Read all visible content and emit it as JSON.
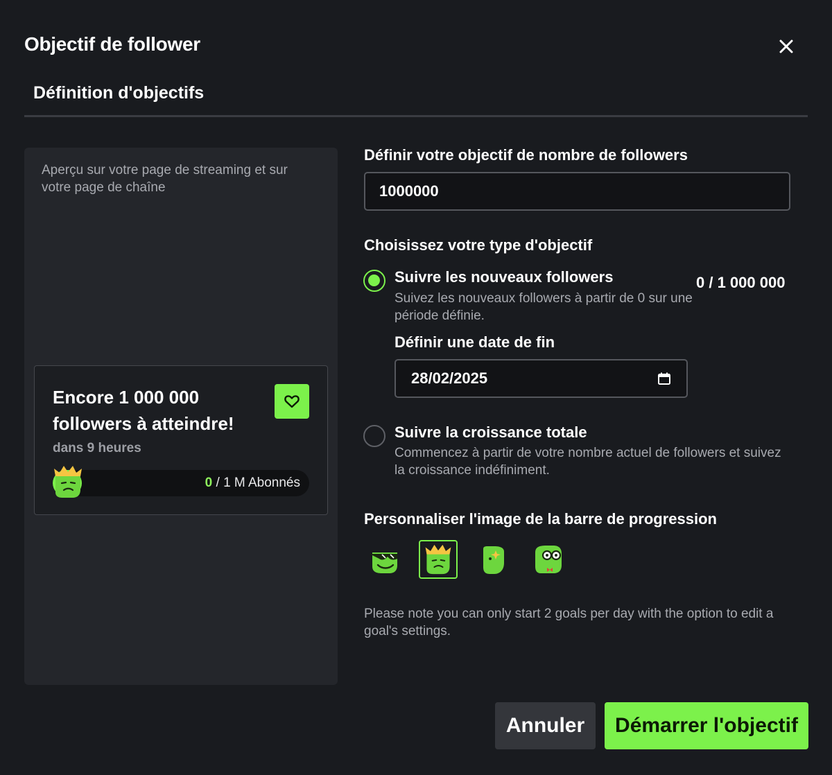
{
  "dialog": {
    "title": "Objectif de follower",
    "tab": "Définition d'objectifs"
  },
  "preview": {
    "caption": "Aperçu sur votre page de streaming et sur votre page de chaîne",
    "card": {
      "title": "Encore 1 000 000 followers à atteindre!",
      "time": "dans 9 heures",
      "current": "0",
      "target": " / 1 M Abonnés",
      "progress_fraction": 0.0
    }
  },
  "form": {
    "goal_label": "Définir votre objectif de nombre de followers",
    "goal_value": "1000000",
    "type_label": "Choisissez votre type d'objectif",
    "option_new": {
      "title": "Suivre les nouveaux followers",
      "desc": "Suivez les nouveaux followers à partir de 0 sur une période définie.",
      "checked": true,
      "count": "0 / 1 000 000"
    },
    "end_date_label": "Définir une date de fin",
    "end_date_value": "28/02/2025",
    "option_total": {
      "title": "Suivre la croissance totale",
      "desc": "Commencez à partir de votre nombre actuel de followers et suivez la croissance indéfiniment.",
      "checked": false
    },
    "image_label": "Personnaliser l'image de la barre de progression",
    "images": [
      "sunglasses-avatar",
      "crown-avatar",
      "sparkle-avatar",
      "glasses-bowtie-avatar"
    ],
    "selected_image": "crown-avatar",
    "note": "Please note you can only start 2 goals per day with the option to edit a goal's settings."
  },
  "buttons": {
    "cancel": "Annuler",
    "start": "Démarrer l'objectif"
  },
  "colors": {
    "accent": "#7cf14b",
    "background": "#191b1f",
    "panel": "#24262b"
  }
}
